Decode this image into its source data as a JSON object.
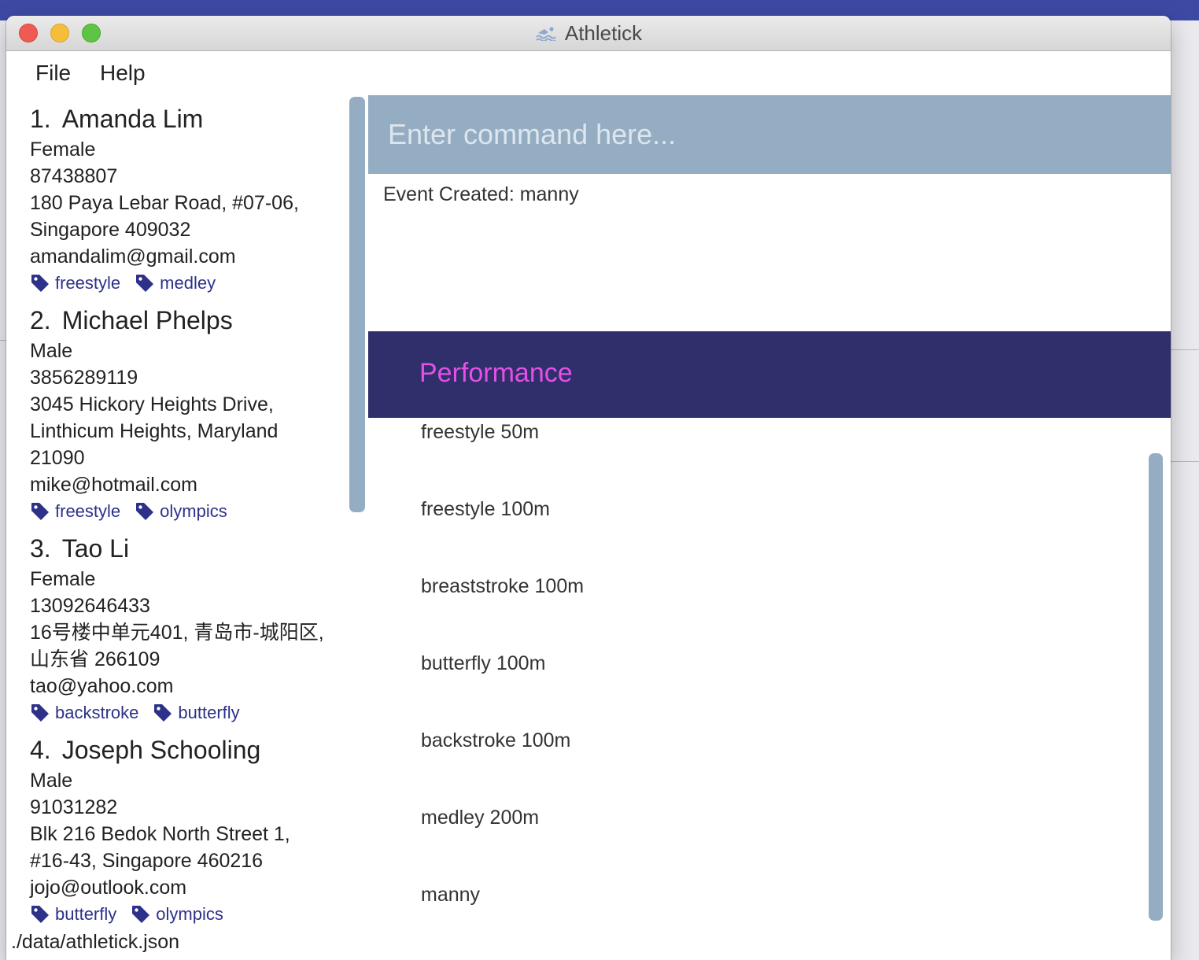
{
  "window": {
    "title": "Athletick"
  },
  "menu": {
    "items": [
      "File",
      "Help"
    ]
  },
  "people": [
    {
      "index": "1.",
      "name": "Amanda Lim",
      "gender": "Female",
      "phone": "87438807",
      "address_lines": [
        "180 Paya Lebar Road, #07-06,",
        "Singapore 409032"
      ],
      "email": "amandalim@gmail.com",
      "tags": [
        "freestyle",
        "medley"
      ]
    },
    {
      "index": "2.",
      "name": "Michael Phelps",
      "gender": "Male",
      "phone": "3856289119",
      "address_lines": [
        "3045 Hickory Heights Drive,",
        "Linthicum Heights, Maryland",
        "21090"
      ],
      "email": "mike@hotmail.com",
      "tags": [
        "freestyle",
        "olympics"
      ]
    },
    {
      "index": "3.",
      "name": "Tao Li",
      "gender": "Female",
      "phone": "13092646433",
      "address_lines": [
        "16号楼中单元401, 青岛市-城阳区,",
        "山东省 266109"
      ],
      "email": "tao@yahoo.com",
      "tags": [
        "backstroke",
        "butterfly"
      ]
    },
    {
      "index": "4.",
      "name": "Joseph Schooling",
      "gender": "Male",
      "phone": "91031282",
      "address_lines": [
        "Blk 216 Bedok North Street 1,",
        "#16-43, Singapore 460216"
      ],
      "email": "jojo@outlook.com",
      "tags": [
        "butterfly",
        "olympics"
      ]
    }
  ],
  "command_box": {
    "placeholder": "Enter command here..."
  },
  "result_display": {
    "text": "Event Created: manny"
  },
  "performance": {
    "title": "Performance",
    "events": [
      "freestyle 50m",
      "freestyle 100m",
      "breaststroke 100m",
      "butterfly 100m",
      "backstroke 100m",
      "medley 200m",
      "manny"
    ]
  },
  "status_bar": {
    "file_path": "./data/athletick.json"
  },
  "colors": {
    "accent_panel": "#95adc2",
    "header_bg": "#2f2f6b",
    "header_title": "#e64fe6",
    "tag_text": "#2d3189"
  }
}
